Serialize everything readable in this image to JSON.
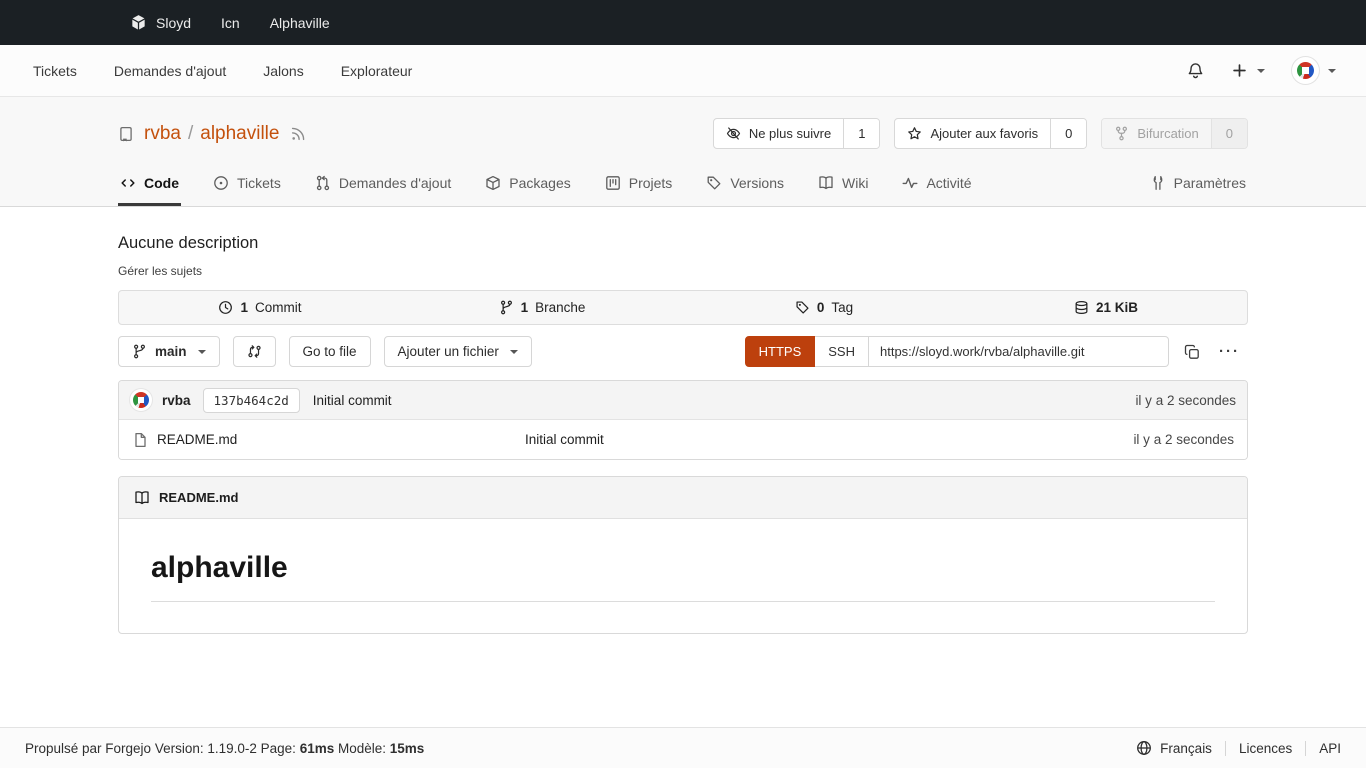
{
  "colors": {
    "accent": "#bd400d",
    "link": "#c4510d",
    "topbar_bg": "#1b2024"
  },
  "topbar": {
    "logo_label": "Sloyd",
    "nav": [
      {
        "label": "Icn"
      },
      {
        "label": "Alphaville"
      }
    ]
  },
  "navbar": {
    "items": [
      {
        "label": "Tickets"
      },
      {
        "label": "Demandes d'ajout"
      },
      {
        "label": "Jalons"
      },
      {
        "label": "Explorateur"
      }
    ]
  },
  "repo": {
    "owner": "rvba",
    "separator": "/",
    "name": "alphaville"
  },
  "repo_actions": {
    "watch": {
      "label": "Ne plus suivre",
      "count": "1"
    },
    "star": {
      "label": "Ajouter aux favoris",
      "count": "0"
    },
    "fork": {
      "label": "Bifurcation",
      "count": "0"
    }
  },
  "tabs": {
    "code": "Code",
    "issues": "Tickets",
    "pulls": "Demandes d'ajout",
    "packages": "Packages",
    "projects": "Projets",
    "releases": "Versions",
    "wiki": "Wiki",
    "activity": "Activité",
    "settings": "Paramètres"
  },
  "overview": {
    "description": "Aucune description",
    "manage_topics": "Gérer les sujets"
  },
  "stats": {
    "commits": {
      "count": "1",
      "label": "Commit"
    },
    "branches": {
      "count": "1",
      "label": "Branche"
    },
    "tags": {
      "count": "0",
      "label": "Tag"
    },
    "size": "21 KiB"
  },
  "toolbar": {
    "branch": "main",
    "goto_file": "Go to file",
    "add_file": "Ajouter un fichier",
    "protocol_https": "HTTPS",
    "protocol_ssh": "SSH",
    "clone_url": "https://sloyd.work/rvba/alphaville.git",
    "kebab": "···"
  },
  "commit": {
    "author": "rvba",
    "hash": "137b464c2d",
    "message": "Initial commit",
    "time": "il y a 2 secondes"
  },
  "files": [
    {
      "name": "README.md",
      "message": "Initial commit",
      "time": "il y a 2 secondes"
    }
  ],
  "readme": {
    "filename": "README.md",
    "heading": "alphaville"
  },
  "footer": {
    "powered": "Propulsé par Forgejo Version: 1.19.0-2 Page:",
    "page_time": "61ms",
    "template_label": "Modèle:",
    "template_time": "15ms",
    "language": "Français",
    "links": [
      {
        "label": "Licences"
      },
      {
        "label": "API"
      }
    ]
  }
}
